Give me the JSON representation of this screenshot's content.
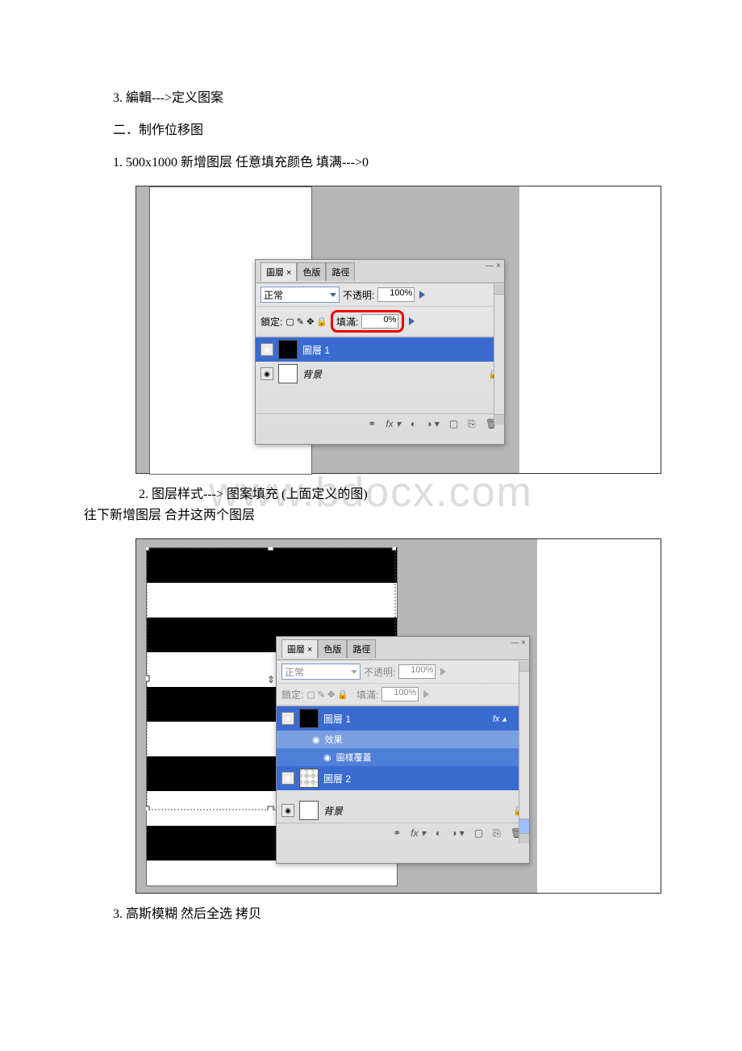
{
  "watermark": "www.bdocx.com",
  "body_text": {
    "l1": "3. 編輯--->定义图案",
    "l2": "二．制作位移图",
    "l3": "1. 500x1000 新增图层 任意填充颜色 填满--->0",
    "l4": "2. 图层样式---> 图案填充 (上面定义的图)",
    "l5": "往下新增图层 合并这两个图层",
    "l6": "3. 高斯模糊 然后全选 拷贝"
  },
  "panel": {
    "tabs": {
      "layers": "圖層",
      "channels": "色版",
      "paths": "路徑"
    },
    "close_x": "— ×",
    "menu_glyph": "▾≡",
    "blend_label": "正常",
    "opacity_label": "不透明:",
    "opacity_val_100": "100%",
    "lock_label": "鎖定:",
    "lock_icons": "▢ ✎ ✥ 🔒",
    "fill_label": "填滿:",
    "fill_val_0": "0%",
    "fill_val_100": "100%",
    "layer1": "圖層 1",
    "layer2": "圖層 2",
    "bg": "背景",
    "effects": "效果",
    "pattern_overlay": "圖樣覆蓋",
    "fx": "fx",
    "lock_glyph": "🔒",
    "eye_glyph": "◉",
    "foot": {
      "link": "⚭",
      "fx": "fx ▾",
      "mask": "◐",
      "adj": "◑ ▾",
      "folder": "▢",
      "new": "⎘",
      "trash": "🗑"
    }
  }
}
